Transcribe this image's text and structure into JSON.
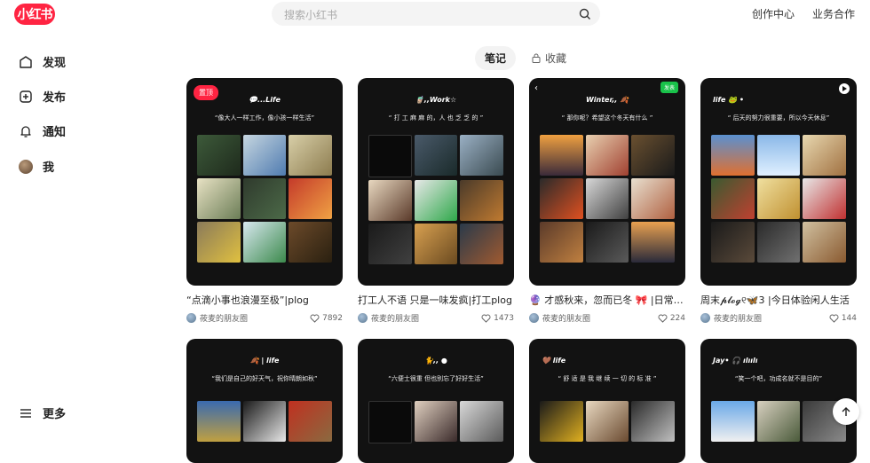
{
  "header": {
    "logo": "小红书",
    "search_placeholder": "搜索小红书",
    "links": [
      "创作中心",
      "业务合作"
    ]
  },
  "sidebar": {
    "items": [
      {
        "label": "发现",
        "icon": "compass-icon"
      },
      {
        "label": "发布",
        "icon": "plus-square-icon"
      },
      {
        "label": "通知",
        "icon": "bell-icon"
      },
      {
        "label": "我",
        "icon": "avatar"
      }
    ],
    "more": "更多"
  },
  "tabs": {
    "notes": "笔记",
    "saved": "收藏"
  },
  "cards": [
    {
      "badge": "置顶",
      "cover_title": "💬...Life",
      "cover_quote": "“像大人一样工作，像小孩一样生活”",
      "title": "“点滴小事也浪漫至极”|plog",
      "author": "莜麦的朋友圈",
      "likes": "7892"
    },
    {
      "cover_title": "🧋,,Work☆",
      "cover_quote": "“ 打 工 麻 麻 的，人 也 乏 乏 的 ”",
      "title": "打工人不语 只是一味发疯|打工plog",
      "author": "莜麦的朋友圈",
      "likes": "1473"
    },
    {
      "tag": "发表",
      "cover_title": "Winter,, 🍂",
      "cover_quote": "“ 那你呢？希望这个冬天有什么 ”",
      "title": "🔮 才感秋来，忽而已冬 🎀 |日常plog",
      "author": "莜麦的朋友圈",
      "likes": "224"
    },
    {
      "cover_title": "life 🐸 •",
      "cover_quote": "“ 后天的努力很重要，所以今天休息”",
      "title": "周末𝓹𝓵𝓸𝓰୧🦋3 |今日体验闲人生活",
      "author": "莜麦的朋友圈",
      "likes": "144"
    },
    {
      "cover_title": "🍂 | life",
      "cover_quote": "“我们是自己的好天气，祝你晴朗如秋”"
    },
    {
      "cover_title": "🐈,, ●",
      "cover_quote": "“六便士很重 但也别忘了好好生活”"
    },
    {
      "cover_title": "🤎 life",
      "cover_quote": "“ 舒 适 是 我 继 续 一 切 的 标 准 ”"
    },
    {
      "cover_title": "Jay• 🎧 ılıılı",
      "cover_quote": "“笑一个吧，功成名就不是目的”"
    }
  ],
  "colors": {
    "brand": "#ff2442",
    "cover_bg": "#121212"
  }
}
